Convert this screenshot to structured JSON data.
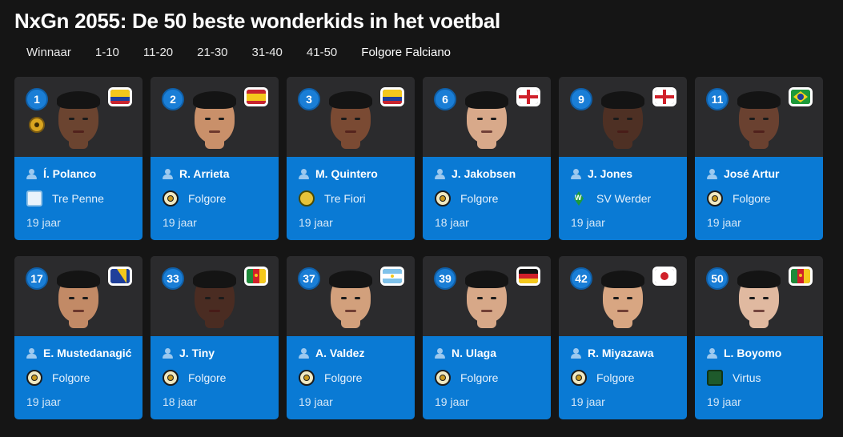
{
  "page": {
    "title": "NxGn 2055: De 50 beste wonderkids in het voetbal"
  },
  "tabs": [
    {
      "label": "Winnaar"
    },
    {
      "label": "1-10"
    },
    {
      "label": "11-20"
    },
    {
      "label": "21-30"
    },
    {
      "label": "31-40"
    },
    {
      "label": "41-50"
    },
    {
      "label": "Folgore Falciano",
      "active": true
    }
  ],
  "colors": {
    "background": "#151515",
    "card_top": "#2b2b2d",
    "card_bottom": "#0a7ad4",
    "rank_badge": "#1a7ed6"
  },
  "players": [
    {
      "rank": "1",
      "name": "Í. Polanco",
      "club": "Tre Penne",
      "club_icon": "shield-icon",
      "age": "19 jaar",
      "flag": "colombia",
      "skin": "#6b4430",
      "award": true
    },
    {
      "rank": "2",
      "name": "R. Arrieta",
      "club": "Folgore",
      "club_icon": "folgore-crest-icon",
      "age": "19 jaar",
      "flag": "spain",
      "skin": "#c9906a"
    },
    {
      "rank": "3",
      "name": "M. Quintero",
      "club": "Tre Fiori",
      "club_icon": "tre-fiori-crest-icon",
      "age": "19 jaar",
      "flag": "colombia",
      "skin": "#7a4a33"
    },
    {
      "rank": "6",
      "name": "J. Jakobsen",
      "club": "Folgore",
      "club_icon": "folgore-crest-icon",
      "age": "18 jaar",
      "flag": "england",
      "skin": "#d8a98a"
    },
    {
      "rank": "9",
      "name": "J. Jones",
      "club": "SV Werder",
      "club_icon": "werder-crest-icon",
      "age": "19 jaar",
      "flag": "england",
      "skin": "#4e3024"
    },
    {
      "rank": "11",
      "name": "José Artur",
      "club": "Folgore",
      "club_icon": "folgore-crest-icon",
      "age": "19 jaar",
      "flag": "brazil",
      "skin": "#6a4130"
    },
    {
      "rank": "17",
      "name": "E. Mustedanagić",
      "club": "Folgore",
      "club_icon": "folgore-crest-icon",
      "age": "19 jaar",
      "flag": "bosnia",
      "skin": "#c28a66"
    },
    {
      "rank": "33",
      "name": "J. Tiny",
      "club": "Folgore",
      "club_icon": "folgore-crest-icon",
      "age": "18 jaar",
      "flag": "cameroon",
      "skin": "#4a2c22"
    },
    {
      "rank": "37",
      "name": "A. Valdez",
      "club": "Folgore",
      "club_icon": "folgore-crest-icon",
      "age": "19 jaar",
      "flag": "argentina",
      "skin": "#d2a07c"
    },
    {
      "rank": "39",
      "name": "N. Ulaga",
      "club": "Folgore",
      "club_icon": "folgore-crest-icon",
      "age": "19 jaar",
      "flag": "germany",
      "skin": "#d7a888"
    },
    {
      "rank": "42",
      "name": "R. Miyazawa",
      "club": "Folgore",
      "club_icon": "folgore-crest-icon",
      "age": "19 jaar",
      "flag": "japan",
      "skin": "#d8a682"
    },
    {
      "rank": "50",
      "name": "L. Boyomo",
      "club": "Virtus",
      "club_icon": "virtus-crest-icon",
      "age": "19 jaar",
      "flag": "cameroon",
      "skin": "#e0b9a0"
    }
  ]
}
